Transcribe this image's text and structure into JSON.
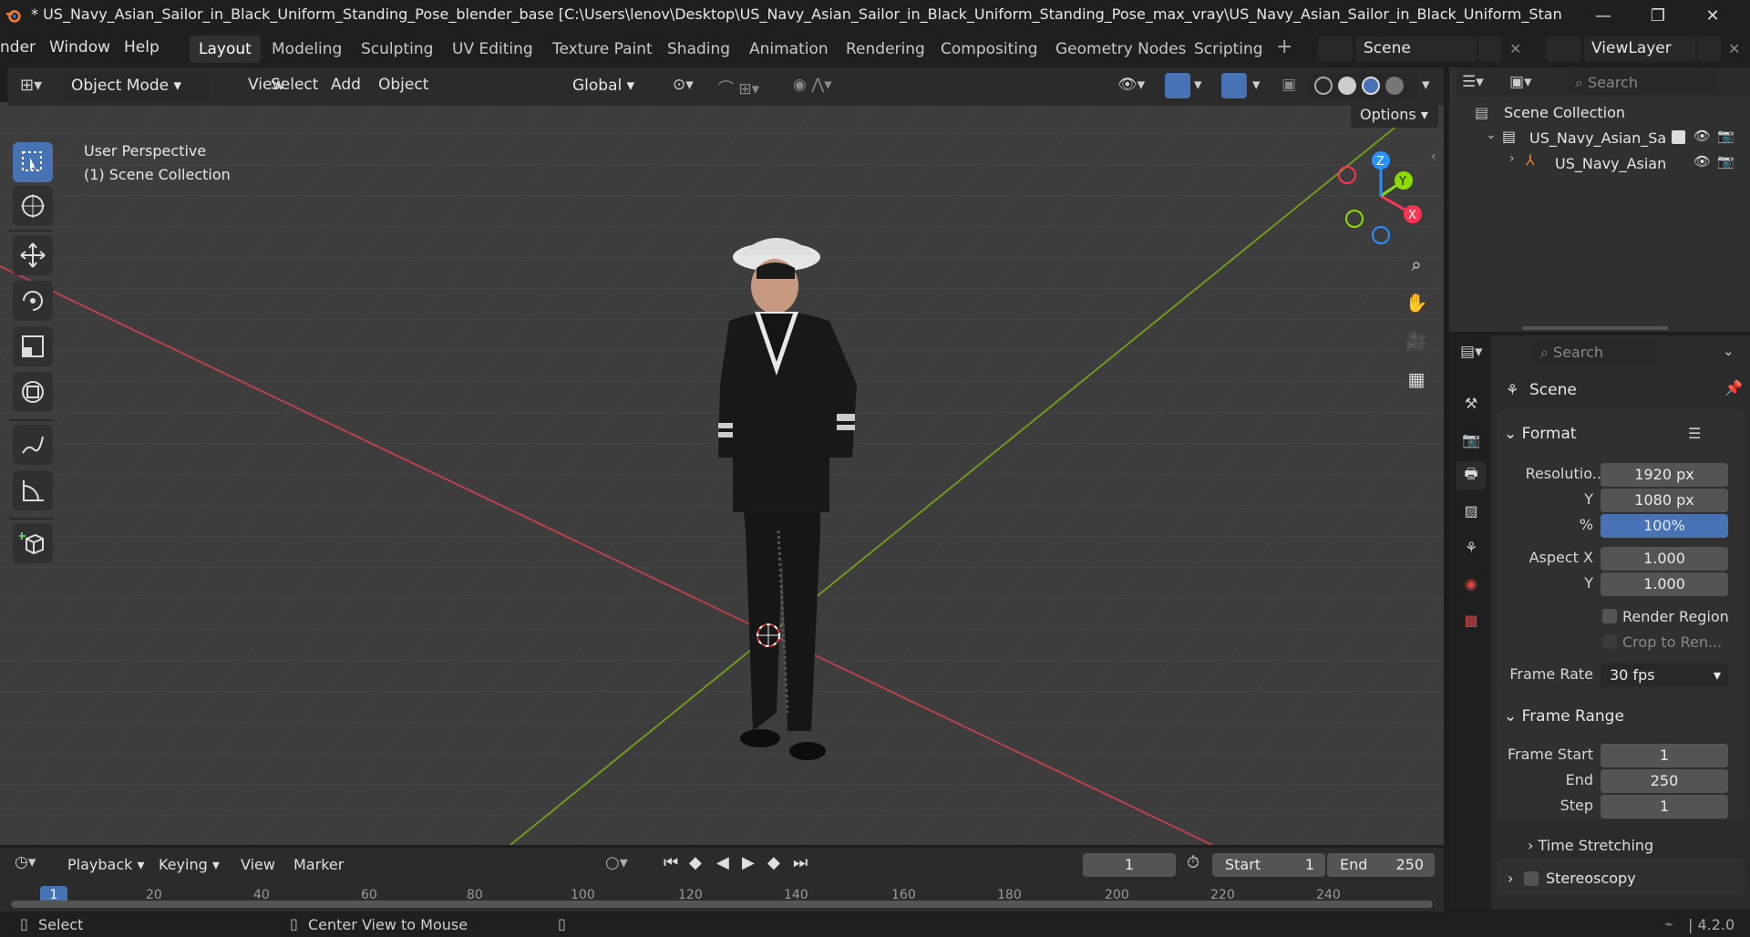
{
  "window": {
    "title": "* US_Navy_Asian_Sailor_in_Black_Uniform_Standing_Pose_blender_base [C:\\Users\\lenov\\Desktop\\US_Navy_Asian_Sailor_in_Black_Uniform_Standing_Pose_max_vray\\US_Navy_Asian_Sailor_in_Black_Uniform_Standing_Pose_blen...",
    "minimize": "—",
    "maximize": "❐",
    "close": "✕"
  },
  "menus": [
    "nder",
    "Window",
    "Help"
  ],
  "workspace_tabs": [
    {
      "label": "Layout",
      "active": true
    },
    {
      "label": "Modeling"
    },
    {
      "label": "Sculpting"
    },
    {
      "label": "UV Editing"
    },
    {
      "label": "Texture Paint"
    },
    {
      "label": "Shading"
    },
    {
      "label": "Animation"
    },
    {
      "label": "Rendering"
    },
    {
      "label": "Compositing"
    },
    {
      "label": "Geometry Nodes"
    },
    {
      "label": "Scripting"
    }
  ],
  "add_workspace": "+",
  "scene_selector": {
    "value": "Scene"
  },
  "viewlayer_selector": {
    "value": "ViewLayer"
  },
  "viewport_header": {
    "mode": "Object Mode",
    "menus": [
      "View",
      "Select",
      "Add",
      "Object"
    ],
    "orientation": "Global",
    "options_label": "Options"
  },
  "viewport": {
    "perspective_label": "User Perspective",
    "collection_label": "(1) Scene Collection",
    "gizmo_axes": {
      "x": "X",
      "y": "Y",
      "z": "Z"
    },
    "colors": {
      "x_axis": "#ff3352",
      "y_axis": "#8bdc00",
      "z_axis": "#2890ff",
      "bg": "#3d3d3d",
      "grid": "#484848"
    }
  },
  "toolbar_icons": [
    "select-box-icon",
    "cursor-icon",
    "move-icon",
    "rotate-icon",
    "scale-icon",
    "transform-icon",
    "annotate-icon",
    "measure-icon",
    "add-cube-icon"
  ],
  "outliner": {
    "search_placeholder": "Search",
    "root": "Scene Collection",
    "items": [
      {
        "label": "US_Navy_Asian_Sa",
        "type": "collection"
      },
      {
        "label": "US_Navy_Asian",
        "type": "armature"
      }
    ]
  },
  "properties": {
    "search_placeholder": "Search",
    "context": "Scene",
    "format": {
      "title": "Format",
      "rows": [
        {
          "label": "Resolutio...",
          "value": "1920 px"
        },
        {
          "label": "Y",
          "value": "1080 px"
        },
        {
          "label": "%",
          "value": "100%"
        },
        {
          "label": "Aspect X",
          "value": "1.000"
        },
        {
          "label": "Y",
          "value": "1.000"
        }
      ],
      "render_region": "Render Region",
      "crop": "Crop to Ren...",
      "frame_rate_label": "Frame Rate",
      "frame_rate": "30 fps"
    },
    "frame_range": {
      "title": "Frame Range",
      "rows": [
        {
          "label": "Frame Start",
          "value": "1"
        },
        {
          "label": "End",
          "value": "250"
        },
        {
          "label": "Step",
          "value": "1"
        }
      ],
      "time_stretching": "Time Stretching"
    },
    "stereoscopy": "Stereoscopy"
  },
  "timeline": {
    "menus": [
      "Playback",
      "Keying",
      "View",
      "Marker"
    ],
    "current_frame": "1",
    "start_label": "Start",
    "start": "1",
    "end_label": "End",
    "end": "250",
    "ticks": [
      "1",
      "20",
      "40",
      "60",
      "80",
      "100",
      "120",
      "140",
      "160",
      "180",
      "200",
      "220",
      "240"
    ]
  },
  "statusbar": {
    "select": "Select",
    "center_view": "Center View to Mouse",
    "version": "4.2.0"
  }
}
